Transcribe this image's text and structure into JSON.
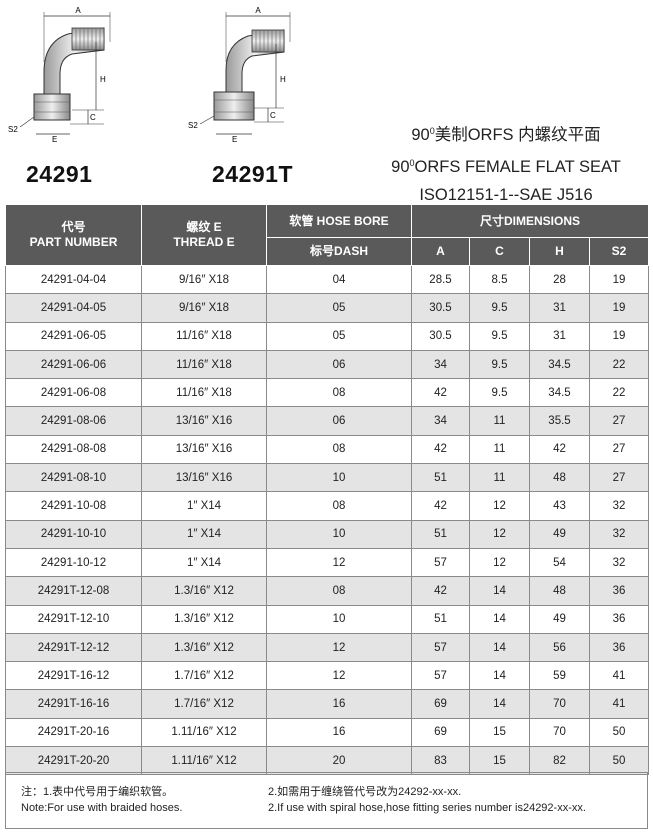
{
  "drawings": [
    {
      "part": "24291",
      "dims": {
        "a": "A",
        "h": "H",
        "c": "C",
        "e": "E",
        "s2": "S2"
      }
    },
    {
      "part": "24291T",
      "dims": {
        "a": "A",
        "h": "H",
        "c": "C",
        "e": "E",
        "s2": "S2"
      }
    }
  ],
  "title": {
    "line1_pre": "90",
    "line1_sup": "0",
    "line1_post": "美制ORFS 内螺纹平面",
    "line2_pre": "90",
    "line2_sup": "0",
    "line2_post": "ORFS FEMALE FLAT SEAT",
    "line3": "ISO12151-1--SAE J516"
  },
  "table": {
    "headers": {
      "part_cn": "代号",
      "part_en": "PART NUMBER",
      "thread_cn": "螺纹 E",
      "thread_en": "THREAD E",
      "bore": "软管 HOSE BORE",
      "dash": "标号DASH",
      "dimensions": "尺寸DIMENSIONS",
      "a": "A",
      "c": "C",
      "h": "H",
      "s2": "S2"
    },
    "rows": [
      [
        "24291-04-04",
        "9/16″ X18",
        "04",
        "28.5",
        "8.5",
        "28",
        "19"
      ],
      [
        "24291-04-05",
        "9/16″ X18",
        "05",
        "30.5",
        "9.5",
        "31",
        "19"
      ],
      [
        "24291-06-05",
        "11/16″ X18",
        "05",
        "30.5",
        "9.5",
        "31",
        "19"
      ],
      [
        "24291-06-06",
        "11/16″ X18",
        "06",
        "34",
        "9.5",
        "34.5",
        "22"
      ],
      [
        "24291-06-08",
        "11/16″ X18",
        "08",
        "42",
        "9.5",
        "34.5",
        "22"
      ],
      [
        "24291-08-06",
        "13/16″ X16",
        "06",
        "34",
        "11",
        "35.5",
        "27"
      ],
      [
        "24291-08-08",
        "13/16″ X16",
        "08",
        "42",
        "11",
        "42",
        "27"
      ],
      [
        "24291-08-10",
        "13/16″ X16",
        "10",
        "51",
        "11",
        "48",
        "27"
      ],
      [
        "24291-10-08",
        "1″ X14",
        "08",
        "42",
        "12",
        "43",
        "32"
      ],
      [
        "24291-10-10",
        "1″ X14",
        "10",
        "51",
        "12",
        "49",
        "32"
      ],
      [
        "24291-10-12",
        "1″ X14",
        "12",
        "57",
        "12",
        "54",
        "32"
      ],
      [
        "24291T-12-08",
        "1.3/16″ X12",
        "08",
        "42",
        "14",
        "48",
        "36"
      ],
      [
        "24291T-12-10",
        "1.3/16″ X12",
        "10",
        "51",
        "14",
        "49",
        "36"
      ],
      [
        "24291T-12-12",
        "1.3/16″ X12",
        "12",
        "57",
        "14",
        "56",
        "36"
      ],
      [
        "24291T-16-12",
        "1.7/16″ X12",
        "12",
        "57",
        "14",
        "59",
        "41"
      ],
      [
        "24291T-16-16",
        "1.7/16″ X12",
        "16",
        "69",
        "14",
        "70",
        "41"
      ],
      [
        "24291T-20-16",
        "1.11/16″ X12",
        "16",
        "69",
        "15",
        "70",
        "50"
      ],
      [
        "24291T-20-20",
        "1.11/16″ X12",
        "20",
        "83",
        "15",
        "82",
        "50"
      ]
    ]
  },
  "notes": {
    "n1_cn": "注：1.表中代号用于编织软管。",
    "n1_en": "Note:For use with braided hoses.",
    "n2_cn": "2.如需用于缠绕管代号改为24292-xx-xx.",
    "n2_en": "2.If use with spiral hose,hose fitting series number is24292-xx-xx."
  },
  "colors": {
    "header_bg": "#5a5a5a",
    "alt_row": "#e4e4e4",
    "border": "#8a8a8a",
    "metal": "#c8c8c8"
  }
}
